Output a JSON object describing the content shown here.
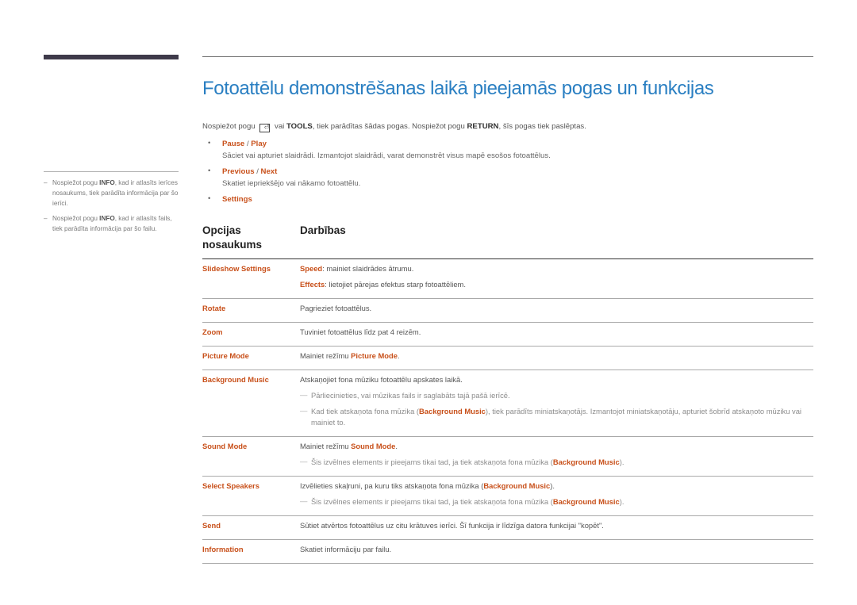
{
  "sidebar": {
    "notes": [
      {
        "pre": "Nospiežot pogu ",
        "key": "INFO",
        "post": ", kad ir atlasīts ierīces nosaukums, tiek parādīta informācija par šo ierīci."
      },
      {
        "pre": "Nospiežot pogu ",
        "key": "INFO",
        "post": ", kad ir atlasīts fails, tiek parādīta informācija par šo failu."
      }
    ]
  },
  "title": "Fotoattēlu demonstrēšanas laikā pieejamās pogas un funkcijas",
  "intro": {
    "part1": "Nospiežot pogu",
    "icon": "tools-icon",
    "part2": "vai",
    "key1": "TOOLS",
    "part3": ", tiek parādītas šādas pogas. Nospiežot pogu",
    "key2": "RETURN",
    "part4": ", šīs pogas tiek paslēptas."
  },
  "bullets": [
    {
      "a": "Pause",
      "sep": " / ",
      "b": "Play",
      "desc": "Sāciet vai apturiet slaidrādi. Izmantojot slaidrādi, varat demonstrēt visus mapē esošos fotoattēlus."
    },
    {
      "a": "Previous",
      "sep": " / ",
      "b": "Next",
      "desc": "Skatiet iepriekšējo vai nākamo fotoattēlu."
    },
    {
      "a": "Settings",
      "sep": "",
      "b": "",
      "desc": ""
    }
  ],
  "table": {
    "headers": [
      "Opcijas nosaukums",
      "Darbības"
    ],
    "rows": [
      {
        "name": "Slideshow Settings",
        "lines": [
          {
            "type": "text",
            "hl": "Speed",
            "text": ": mainiet slaidrādes ātrumu."
          },
          {
            "type": "text",
            "hl": "Effects",
            "text": ": lietojiet pārejas efektus starp fotoattēliem."
          }
        ]
      },
      {
        "name": "Rotate",
        "lines": [
          {
            "type": "text",
            "text": "Pagrieziet fotoattēlus."
          }
        ]
      },
      {
        "name": "Zoom",
        "lines": [
          {
            "type": "text",
            "text": "Tuviniet fotoattēlus līdz pat 4 reizēm."
          }
        ]
      },
      {
        "name": "Picture Mode",
        "lines": [
          {
            "type": "text",
            "text": "Mainiet režīmu ",
            "hl_after": "Picture Mode",
            "tail": "."
          }
        ]
      },
      {
        "name": "Background Music",
        "lines": [
          {
            "type": "text",
            "text": "Atskaņojiet fona mūziku fotoattēlu apskates laikā."
          },
          {
            "type": "note",
            "text": "Pārliecinieties, vai mūzikas fails ir saglabāts tajā pašā ierīcē."
          },
          {
            "type": "note",
            "text": "Kad tiek atskaņota fona mūzika (",
            "hl_after": "Background Music",
            "tail": "), tiek parādīts miniatskaņotājs. Izmantojot miniatskaņotāju, apturiet šobrīd atskaņoto mūziku vai mainiet to."
          }
        ]
      },
      {
        "name": "Sound Mode",
        "lines": [
          {
            "type": "text",
            "text": "Mainiet režīmu ",
            "hl_after": "Sound Mode",
            "tail": "."
          },
          {
            "type": "note",
            "text": "Šis izvēlnes elements ir pieejams tikai tad, ja tiek atskaņota fona mūzika (",
            "hl_after": "Background Music",
            "tail": ")."
          }
        ]
      },
      {
        "name": "Select Speakers",
        "lines": [
          {
            "type": "text",
            "text": "Izvēlieties skaļruni, pa kuru tiks atskaņota fona mūzika (",
            "hl_after": "Background Music",
            "tail": ")."
          },
          {
            "type": "note",
            "text": "Šis izvēlnes elements ir pieejams tikai tad, ja tiek atskaņota fona mūzika (",
            "hl_after": "Background Music",
            "tail": ")."
          }
        ]
      },
      {
        "name": "Send",
        "lines": [
          {
            "type": "text",
            "text": "Sūtiet atvērtos fotoattēlus uz citu krātuves ierīci. Šī funkcija ir līdzīga datora funkcijai \"kopēt\"."
          }
        ]
      },
      {
        "name": "Information",
        "lines": [
          {
            "type": "text",
            "text": "Skatiet informāciju par failu."
          }
        ]
      }
    ]
  },
  "colors": {
    "title": "#2a7fc2",
    "accent": "#c8501a",
    "sidebar_bar": "#3e3a4a"
  }
}
